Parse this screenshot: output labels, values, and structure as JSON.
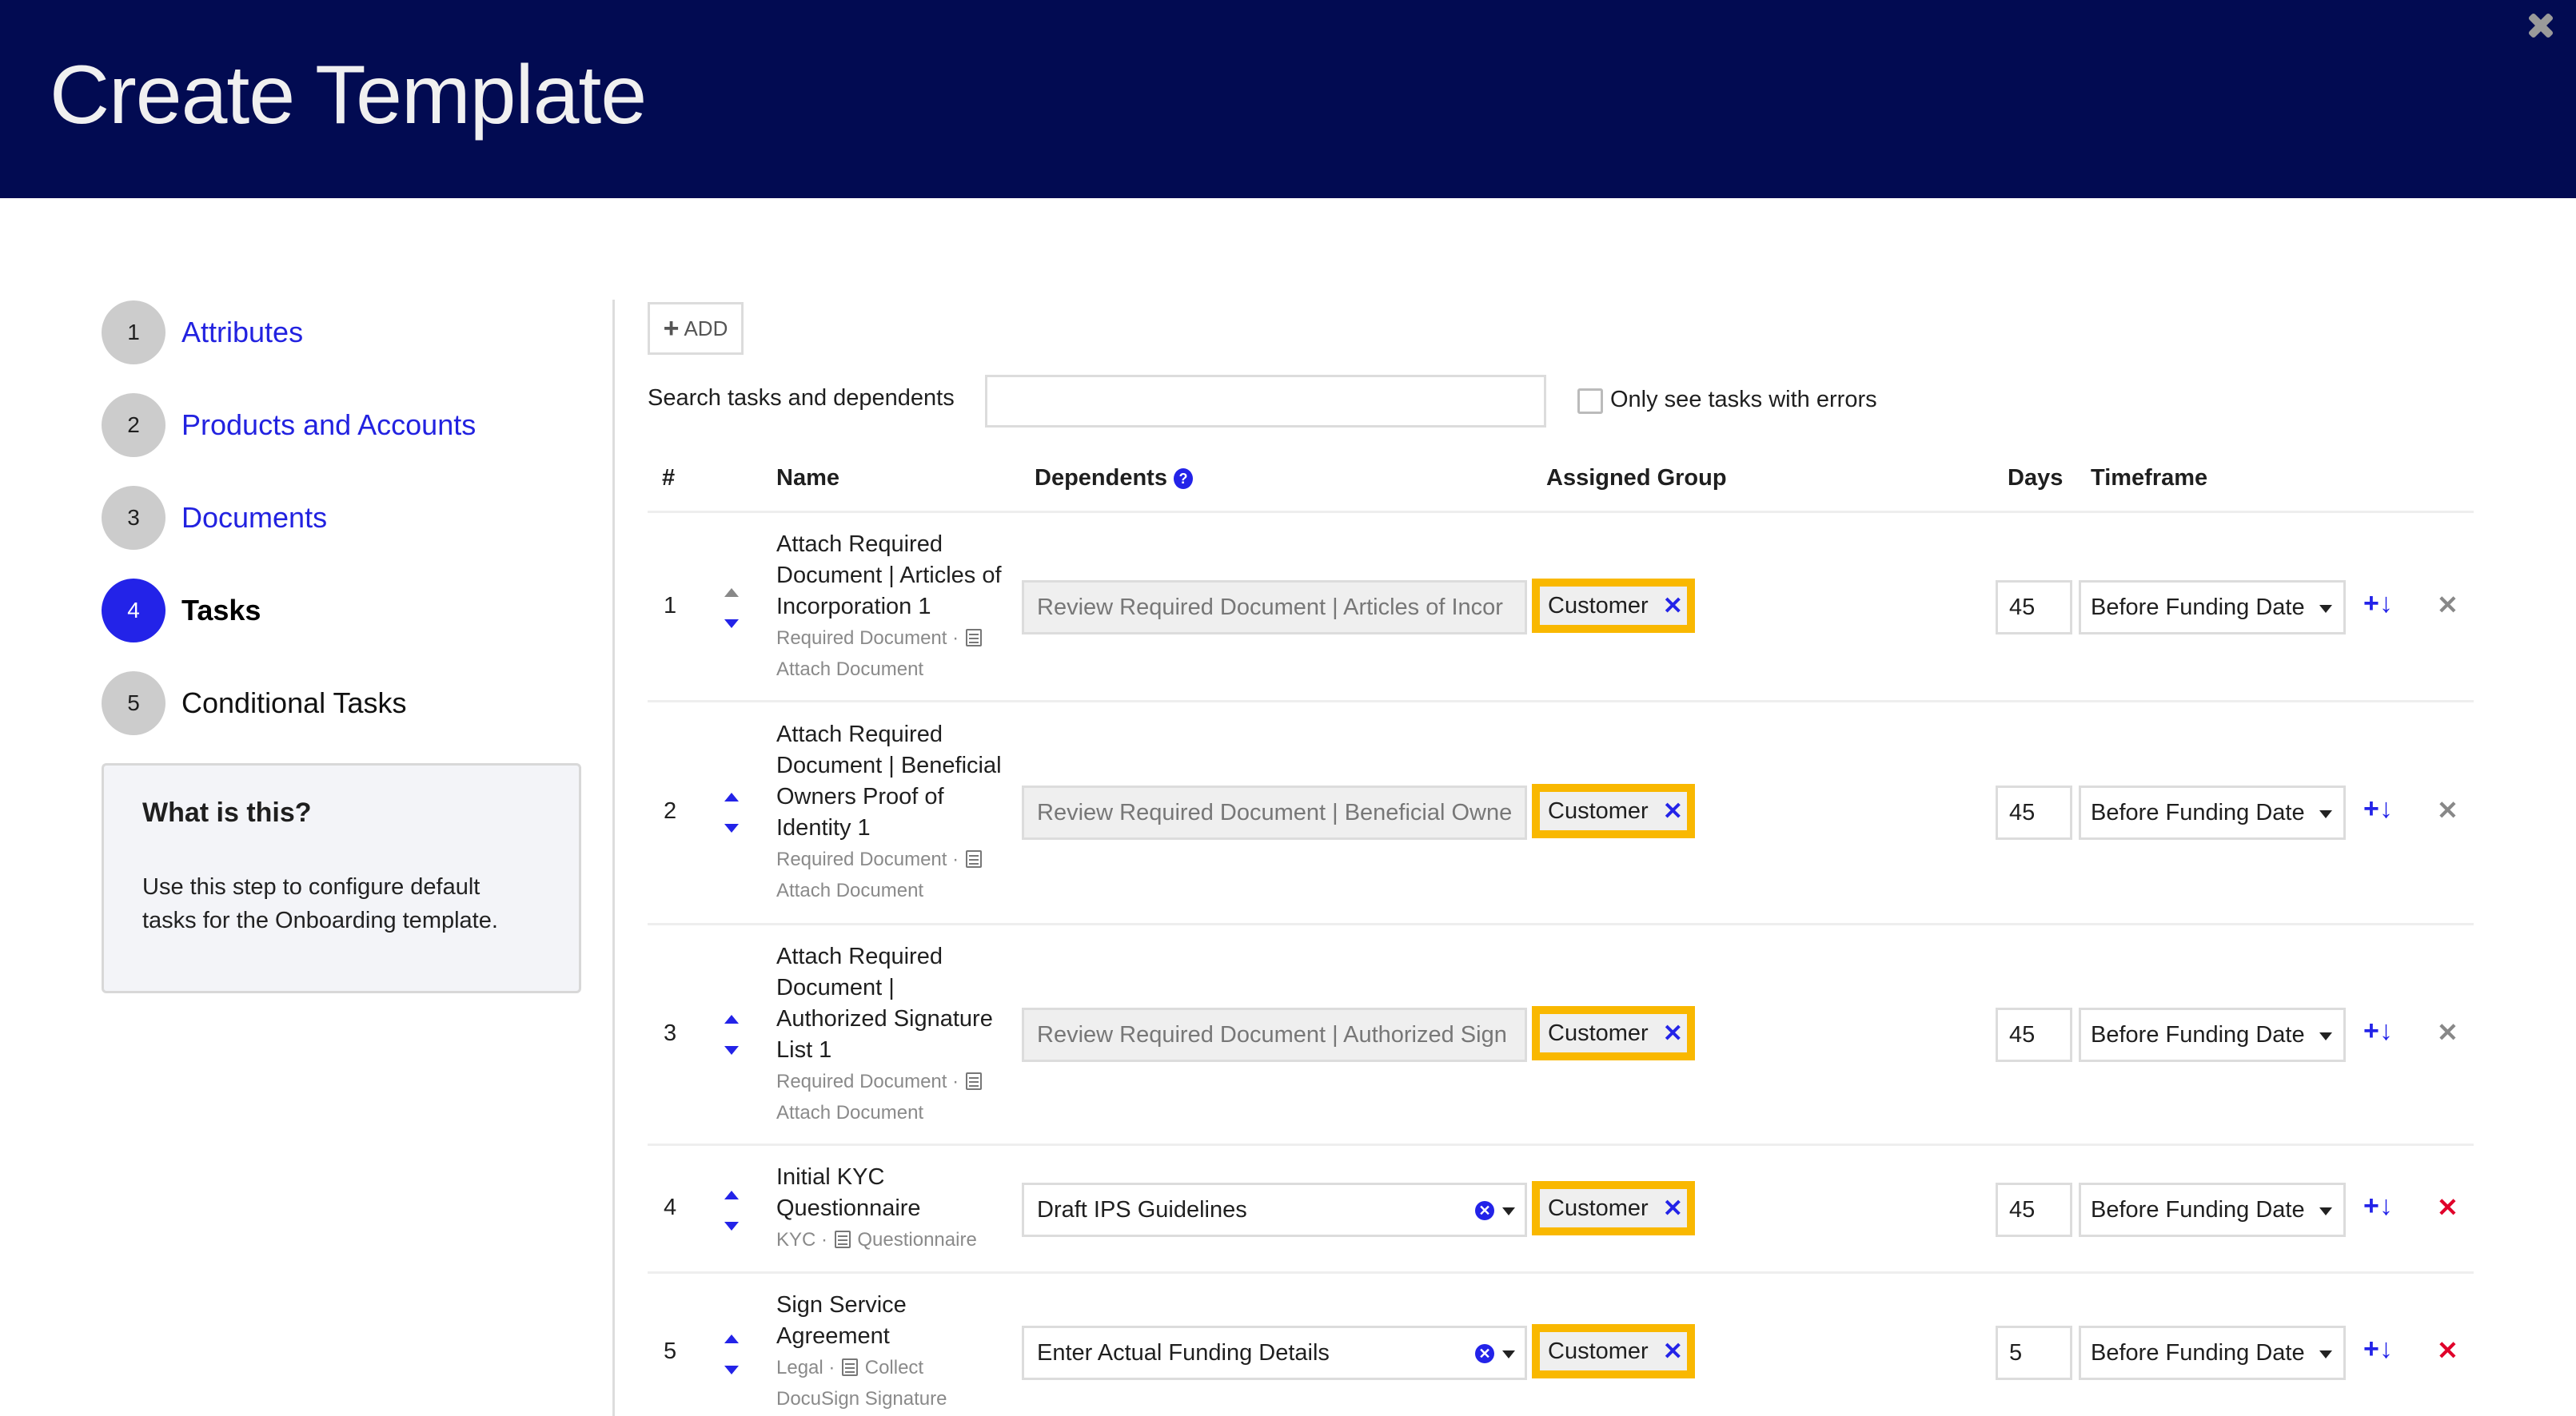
{
  "header": {
    "title": "Create Template",
    "close_icon": "close-icon"
  },
  "steps": [
    {
      "number": "1",
      "label": "Attributes",
      "state": "link"
    },
    {
      "number": "2",
      "label": "Products and Accounts",
      "state": "link"
    },
    {
      "number": "3",
      "label": "Documents",
      "state": "link"
    },
    {
      "number": "4",
      "label": "Tasks",
      "state": "active"
    },
    {
      "number": "5",
      "label": "Conditional Tasks",
      "state": "plain"
    }
  ],
  "info": {
    "title": "What is this?",
    "body": "Use this step to configure default tasks for the Onboarding template."
  },
  "toolbar": {
    "add_label": "ADD",
    "search_label": "Search tasks and dependents",
    "search_value": "",
    "errors_only_label": "Only see tasks with errors",
    "errors_only_checked": false
  },
  "table": {
    "columns": {
      "num": "#",
      "name": "Name",
      "dependents": "Dependents",
      "group": "Assigned Group",
      "days": "Days",
      "timeframe": "Timeframe"
    },
    "rows": [
      {
        "num": "1",
        "name": "Attach Required Document | Articles of Incorporation 1",
        "category": "Required Document",
        "type": "Attach Document",
        "dependent": "Review Required Document | Articles of Incor",
        "dependent_editable": false,
        "group": "Customer",
        "days": "45",
        "timeframe": "Before Funding Date",
        "delete_enabled": false,
        "up_enabled": false
      },
      {
        "num": "2",
        "name": "Attach Required Document | Beneficial Owners Proof of Identity 1",
        "category": "Required Document",
        "type": "Attach Document",
        "dependent": "Review Required Document | Beneficial Owne",
        "dependent_editable": false,
        "group": "Customer",
        "days": "45",
        "timeframe": "Before Funding Date",
        "delete_enabled": false,
        "up_enabled": true
      },
      {
        "num": "3",
        "name": "Attach Required Document | Authorized Signature List 1",
        "category": "Required Document",
        "type": "Attach Document",
        "dependent": "Review Required Document | Authorized Sign",
        "dependent_editable": false,
        "group": "Customer",
        "days": "45",
        "timeframe": "Before Funding Date",
        "delete_enabled": false,
        "up_enabled": true
      },
      {
        "num": "4",
        "name": "Initial KYC Questionnaire",
        "category": "KYC",
        "type": "Questionnaire",
        "dependent": "Draft IPS Guidelines",
        "dependent_editable": true,
        "group": "Customer",
        "days": "45",
        "timeframe": "Before Funding Date",
        "delete_enabled": true,
        "up_enabled": true
      },
      {
        "num": "5",
        "name": "Sign Service Agreement",
        "category": "Legal",
        "type": "Collect DocuSign Signature",
        "dependent": "Enter Actual Funding Details",
        "dependent_editable": true,
        "group": "Customer",
        "days": "5",
        "timeframe": "Before Funding Date",
        "delete_enabled": true,
        "up_enabled": true
      }
    ],
    "add_below_label": "+↓",
    "delete_label": "✕",
    "group_remove_label": "✕",
    "clear_label": "✕",
    "help_label": "?"
  },
  "colors": {
    "header_bg": "#020b52",
    "accent": "#2323e8",
    "highlight": "#f9b800",
    "danger": "#e0002a"
  }
}
